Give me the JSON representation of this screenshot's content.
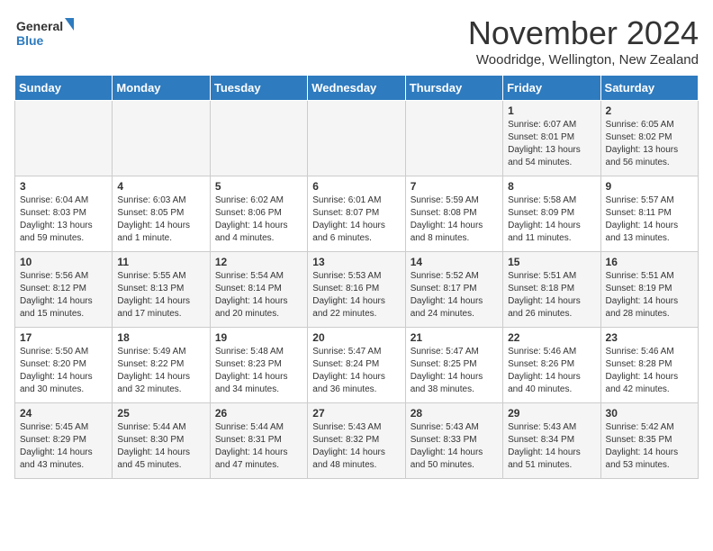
{
  "logo": {
    "general": "General",
    "blue": "Blue"
  },
  "header": {
    "month": "November 2024",
    "location": "Woodridge, Wellington, New Zealand"
  },
  "weekdays": [
    "Sunday",
    "Monday",
    "Tuesday",
    "Wednesday",
    "Thursday",
    "Friday",
    "Saturday"
  ],
  "weeks": [
    [
      {
        "day": "",
        "info": ""
      },
      {
        "day": "",
        "info": ""
      },
      {
        "day": "",
        "info": ""
      },
      {
        "day": "",
        "info": ""
      },
      {
        "day": "",
        "info": ""
      },
      {
        "day": "1",
        "info": "Sunrise: 6:07 AM\nSunset: 8:01 PM\nDaylight: 13 hours and 54 minutes."
      },
      {
        "day": "2",
        "info": "Sunrise: 6:05 AM\nSunset: 8:02 PM\nDaylight: 13 hours and 56 minutes."
      }
    ],
    [
      {
        "day": "3",
        "info": "Sunrise: 6:04 AM\nSunset: 8:03 PM\nDaylight: 13 hours and 59 minutes."
      },
      {
        "day": "4",
        "info": "Sunrise: 6:03 AM\nSunset: 8:05 PM\nDaylight: 14 hours and 1 minute."
      },
      {
        "day": "5",
        "info": "Sunrise: 6:02 AM\nSunset: 8:06 PM\nDaylight: 14 hours and 4 minutes."
      },
      {
        "day": "6",
        "info": "Sunrise: 6:01 AM\nSunset: 8:07 PM\nDaylight: 14 hours and 6 minutes."
      },
      {
        "day": "7",
        "info": "Sunrise: 5:59 AM\nSunset: 8:08 PM\nDaylight: 14 hours and 8 minutes."
      },
      {
        "day": "8",
        "info": "Sunrise: 5:58 AM\nSunset: 8:09 PM\nDaylight: 14 hours and 11 minutes."
      },
      {
        "day": "9",
        "info": "Sunrise: 5:57 AM\nSunset: 8:11 PM\nDaylight: 14 hours and 13 minutes."
      }
    ],
    [
      {
        "day": "10",
        "info": "Sunrise: 5:56 AM\nSunset: 8:12 PM\nDaylight: 14 hours and 15 minutes."
      },
      {
        "day": "11",
        "info": "Sunrise: 5:55 AM\nSunset: 8:13 PM\nDaylight: 14 hours and 17 minutes."
      },
      {
        "day": "12",
        "info": "Sunrise: 5:54 AM\nSunset: 8:14 PM\nDaylight: 14 hours and 20 minutes."
      },
      {
        "day": "13",
        "info": "Sunrise: 5:53 AM\nSunset: 8:16 PM\nDaylight: 14 hours and 22 minutes."
      },
      {
        "day": "14",
        "info": "Sunrise: 5:52 AM\nSunset: 8:17 PM\nDaylight: 14 hours and 24 minutes."
      },
      {
        "day": "15",
        "info": "Sunrise: 5:51 AM\nSunset: 8:18 PM\nDaylight: 14 hours and 26 minutes."
      },
      {
        "day": "16",
        "info": "Sunrise: 5:51 AM\nSunset: 8:19 PM\nDaylight: 14 hours and 28 minutes."
      }
    ],
    [
      {
        "day": "17",
        "info": "Sunrise: 5:50 AM\nSunset: 8:20 PM\nDaylight: 14 hours and 30 minutes."
      },
      {
        "day": "18",
        "info": "Sunrise: 5:49 AM\nSunset: 8:22 PM\nDaylight: 14 hours and 32 minutes."
      },
      {
        "day": "19",
        "info": "Sunrise: 5:48 AM\nSunset: 8:23 PM\nDaylight: 14 hours and 34 minutes."
      },
      {
        "day": "20",
        "info": "Sunrise: 5:47 AM\nSunset: 8:24 PM\nDaylight: 14 hours and 36 minutes."
      },
      {
        "day": "21",
        "info": "Sunrise: 5:47 AM\nSunset: 8:25 PM\nDaylight: 14 hours and 38 minutes."
      },
      {
        "day": "22",
        "info": "Sunrise: 5:46 AM\nSunset: 8:26 PM\nDaylight: 14 hours and 40 minutes."
      },
      {
        "day": "23",
        "info": "Sunrise: 5:46 AM\nSunset: 8:28 PM\nDaylight: 14 hours and 42 minutes."
      }
    ],
    [
      {
        "day": "24",
        "info": "Sunrise: 5:45 AM\nSunset: 8:29 PM\nDaylight: 14 hours and 43 minutes."
      },
      {
        "day": "25",
        "info": "Sunrise: 5:44 AM\nSunset: 8:30 PM\nDaylight: 14 hours and 45 minutes."
      },
      {
        "day": "26",
        "info": "Sunrise: 5:44 AM\nSunset: 8:31 PM\nDaylight: 14 hours and 47 minutes."
      },
      {
        "day": "27",
        "info": "Sunrise: 5:43 AM\nSunset: 8:32 PM\nDaylight: 14 hours and 48 minutes."
      },
      {
        "day": "28",
        "info": "Sunrise: 5:43 AM\nSunset: 8:33 PM\nDaylight: 14 hours and 50 minutes."
      },
      {
        "day": "29",
        "info": "Sunrise: 5:43 AM\nSunset: 8:34 PM\nDaylight: 14 hours and 51 minutes."
      },
      {
        "day": "30",
        "info": "Sunrise: 5:42 AM\nSunset: 8:35 PM\nDaylight: 14 hours and 53 minutes."
      }
    ]
  ]
}
